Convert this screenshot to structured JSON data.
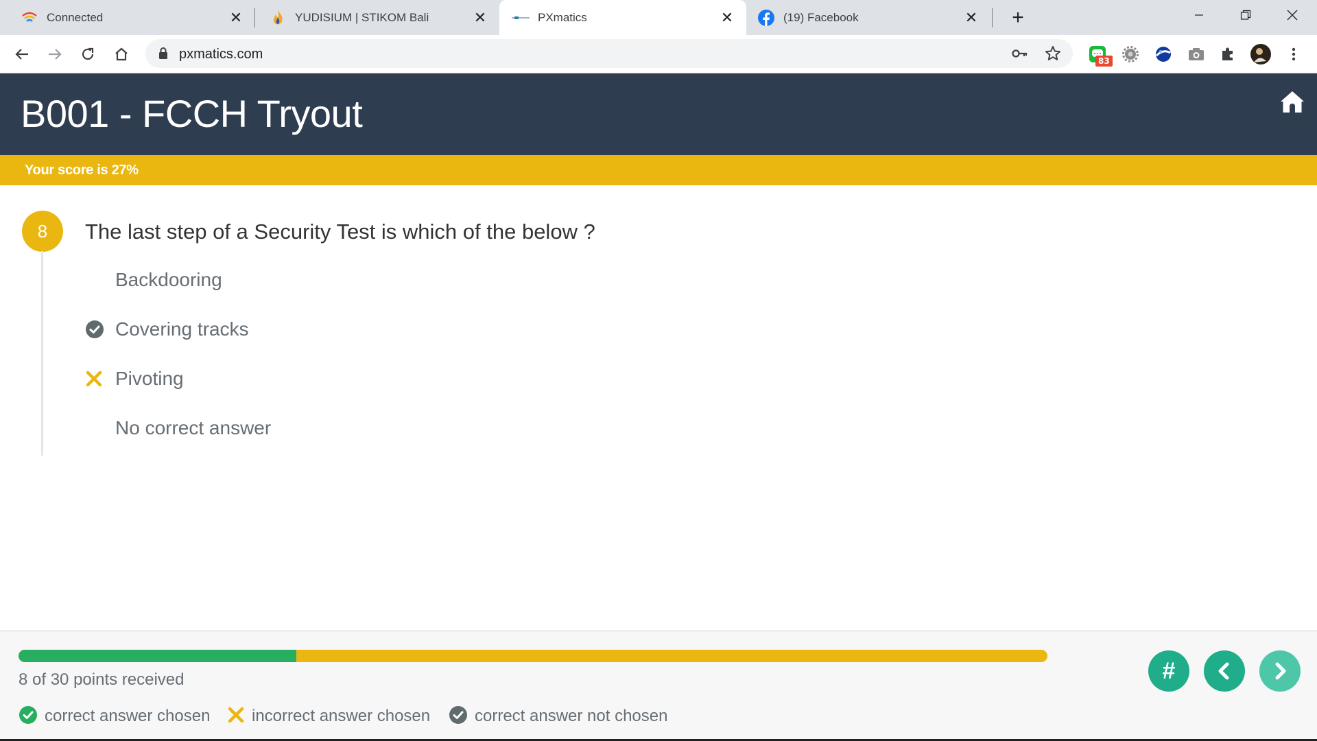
{
  "browser": {
    "tabs": [
      {
        "title": "Connected",
        "favicon": "wifi-icon",
        "active": false
      },
      {
        "title": "YUDISIUM | STIKOM Bali",
        "favicon": "flame-logo-icon",
        "active": false
      },
      {
        "title": "PXmatics",
        "favicon": "pxmatics-logo-icon",
        "active": true
      },
      {
        "title": "(19) Facebook",
        "favicon": "facebook-icon",
        "active": false
      }
    ],
    "url": "pxmatics.com",
    "extension_badge": "83"
  },
  "header": {
    "title": "B001 - FCCH Tryout",
    "score_text": "Your score is 27%"
  },
  "question": {
    "number": "8",
    "text": "The last step of a Security Test is which of the below ?",
    "answers": [
      {
        "label": "Backdooring",
        "mark": "none"
      },
      {
        "label": "Covering tracks",
        "mark": "correct-not-chosen"
      },
      {
        "label": "Pivoting",
        "mark": "incorrect-chosen"
      },
      {
        "label": "No correct answer",
        "mark": "none"
      }
    ]
  },
  "footer": {
    "progress_fraction": 0.27,
    "points_text": "8 of 30 points received",
    "legend": {
      "correct_chosen": "correct answer chosen",
      "incorrect_chosen": "incorrect answer chosen",
      "correct_not_chosen": "correct answer not chosen"
    },
    "buttons": {
      "overview": "#"
    }
  },
  "colors": {
    "header_bg": "#2e3d50",
    "accent_yellow": "#eab711",
    "success_green": "#27ae60",
    "muted_icon": "#5f6b6d",
    "teal_button": "#1fad8a"
  }
}
